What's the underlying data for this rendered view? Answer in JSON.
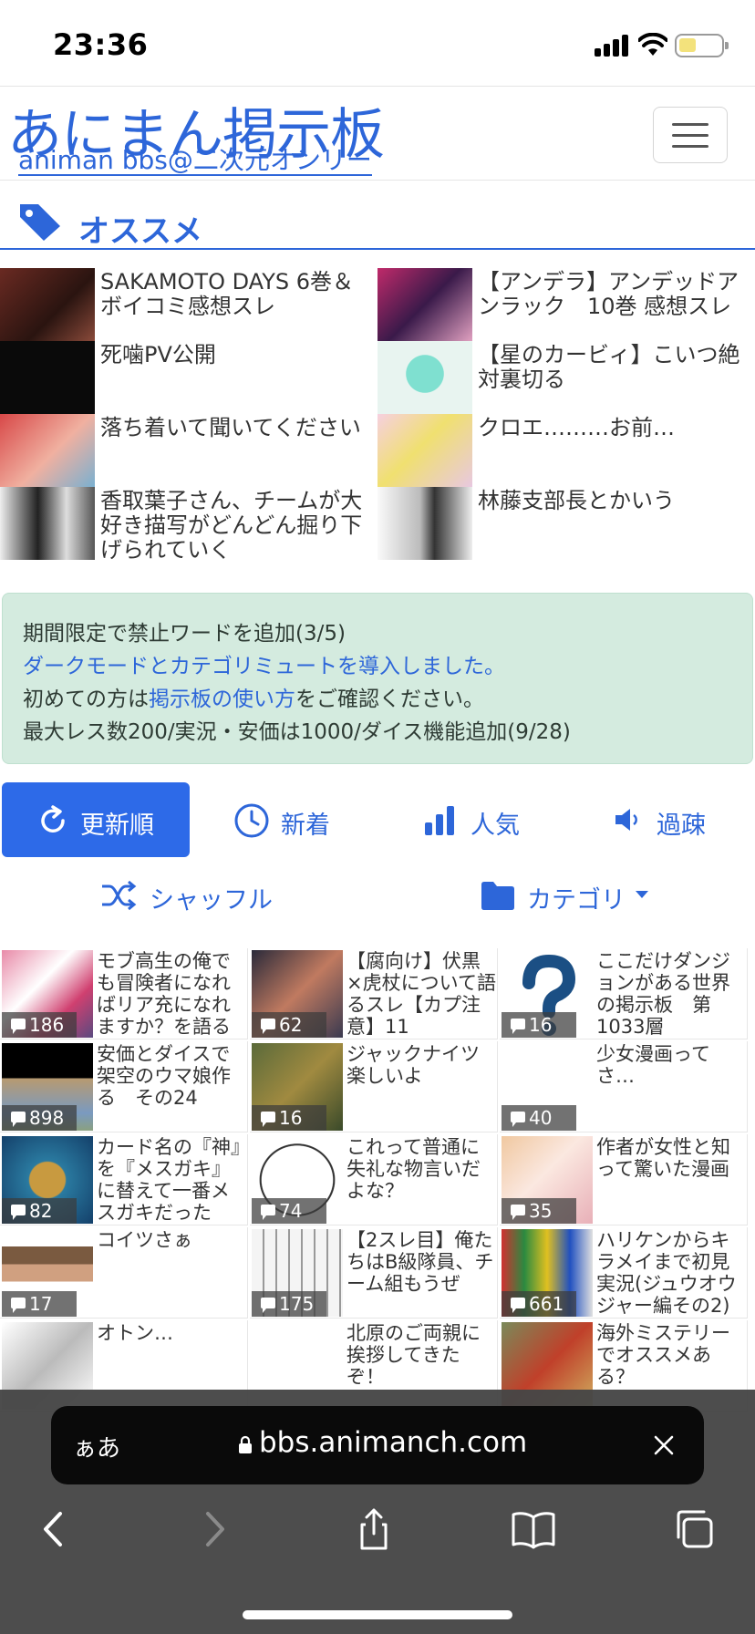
{
  "status": {
    "time": "23:36"
  },
  "site": {
    "title": "あにまん掲示板",
    "subtitle": "animan bbs@二次元オンリー"
  },
  "recommend": {
    "heading": "オススメ",
    "items": [
      {
        "title": "SAKAMOTO DAYS 6巻＆ボイコミ感想スレ",
        "thumb": "manga-cover"
      },
      {
        "title": "【アンデラ】アンデッドアンラック　10巻 感想スレ",
        "thumb": "manga-cover"
      },
      {
        "title": "死噛PV公開",
        "thumb": "title-card"
      },
      {
        "title": "【星のカービィ】こいつ絶対裏切る",
        "thumb": "character"
      },
      {
        "title": "落ち着いて聞いてください",
        "thumb": "character"
      },
      {
        "title": "クロエ………お前…",
        "thumb": "character"
      },
      {
        "title": "香取葉子さん、チームが大好き描写がどんどん掘り下げられていく",
        "thumb": "manga-panel"
      },
      {
        "title": "林藤支部長とかいう",
        "thumb": "manga-panel"
      }
    ]
  },
  "notice": {
    "line1": "期間限定で禁止ワードを追加(3/5)",
    "line2": "ダークモードとカテゴリミュートを導入しました。",
    "line3_pre": "初めての方は",
    "line3_link": "掲示板の使い方",
    "line3_post": "をご確認ください。",
    "line4": "最大レス数200/実況・安価は1000/ダイス機能追加(9/28)"
  },
  "sort": {
    "tabs": [
      {
        "label": "更新順",
        "icon": "refresh-icon",
        "active": true
      },
      {
        "label": "新着",
        "icon": "clock-icon",
        "active": false
      },
      {
        "label": "人気",
        "icon": "bar-chart-icon",
        "active": false
      },
      {
        "label": "過疎",
        "icon": "speaker-icon",
        "active": false
      }
    ],
    "shuffle": "シャッフル",
    "category": "カテゴリ"
  },
  "threads": [
    {
      "title": "モブ高生の俺でも冒険者になればリア充になれますか？を語る",
      "count": "186"
    },
    {
      "title": "【腐向け】伏黒×虎杖について語るスレ【カプ注意】11",
      "count": "62"
    },
    {
      "title": "ここだけダンジョンがある世界の掲示板　第1033層",
      "count": "16"
    },
    {
      "title": "安価とダイスで架空のウマ娘作る　その24",
      "count": "898"
    },
    {
      "title": "ジャックナイツ楽しいよ",
      "count": "16"
    },
    {
      "title": "少女漫画ってさ…",
      "count": "40"
    },
    {
      "title": "カード名の『神』を『メスガキ』に替えて一番メスガキだった",
      "count": "82"
    },
    {
      "title": "これって普通に失礼な物言いだよな？",
      "count": "74"
    },
    {
      "title": "作者が女性と知って驚いた漫画",
      "count": "35"
    },
    {
      "title": "コイツさぁ",
      "count": "17"
    },
    {
      "title": "【2スレ目】俺たちはB級隊員、チーム組もうぜ",
      "count": "175"
    },
    {
      "title": "ハリケンからキラメイまで初見実況(ジュウオウジャー編その2)",
      "count": "661"
    },
    {
      "title": "オトン…",
      "count": ""
    },
    {
      "title": "北原のご両親に挨拶してきたぞ！",
      "count": ""
    },
    {
      "title": "海外ミステリーでオススメある？",
      "count": ""
    }
  ],
  "browser": {
    "aa": "ぁあ",
    "url": "bbs.animanch.com"
  }
}
